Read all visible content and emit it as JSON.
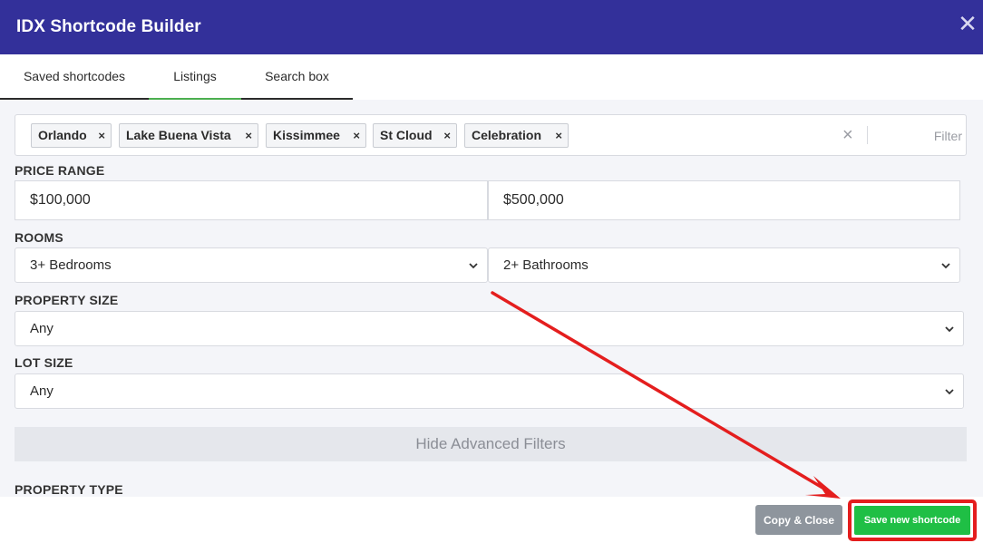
{
  "header": {
    "title": "IDX Shortcode Builder",
    "close_glyph": "✕"
  },
  "tabs": [
    {
      "label": "Saved shortcodes"
    },
    {
      "label": "Listings",
      "active": true
    },
    {
      "label": "Search box"
    }
  ],
  "cities": {
    "chips": [
      "Orlando",
      "Lake Buena Vista",
      "Kissimmee",
      "St Cloud",
      "Celebration"
    ],
    "remove_glyph": "×",
    "clear_glyph": "×",
    "filter_placeholder": "Filter"
  },
  "price_range": {
    "label": "PRICE RANGE",
    "min": "$100,000",
    "max": "$500,000"
  },
  "rooms": {
    "label": "ROOMS",
    "bedrooms": "3+ Bedrooms",
    "bathrooms": "2+ Bathrooms"
  },
  "property_size": {
    "label": "PROPERTY SIZE",
    "value": "Any"
  },
  "lot_size": {
    "label": "LOT SIZE",
    "value": "Any"
  },
  "advanced_toggle": "Hide Advanced Filters",
  "property_type": {
    "label": "PROPERTY TYPE"
  },
  "footer": {
    "copy_close": "Copy & Close",
    "save_new": "Save new shortcode"
  },
  "colors": {
    "header": "#33309a",
    "active_tab": "#4caf50",
    "save": "#1fbf45",
    "copy": "#8e959d",
    "annotation": "#e41e1e"
  }
}
